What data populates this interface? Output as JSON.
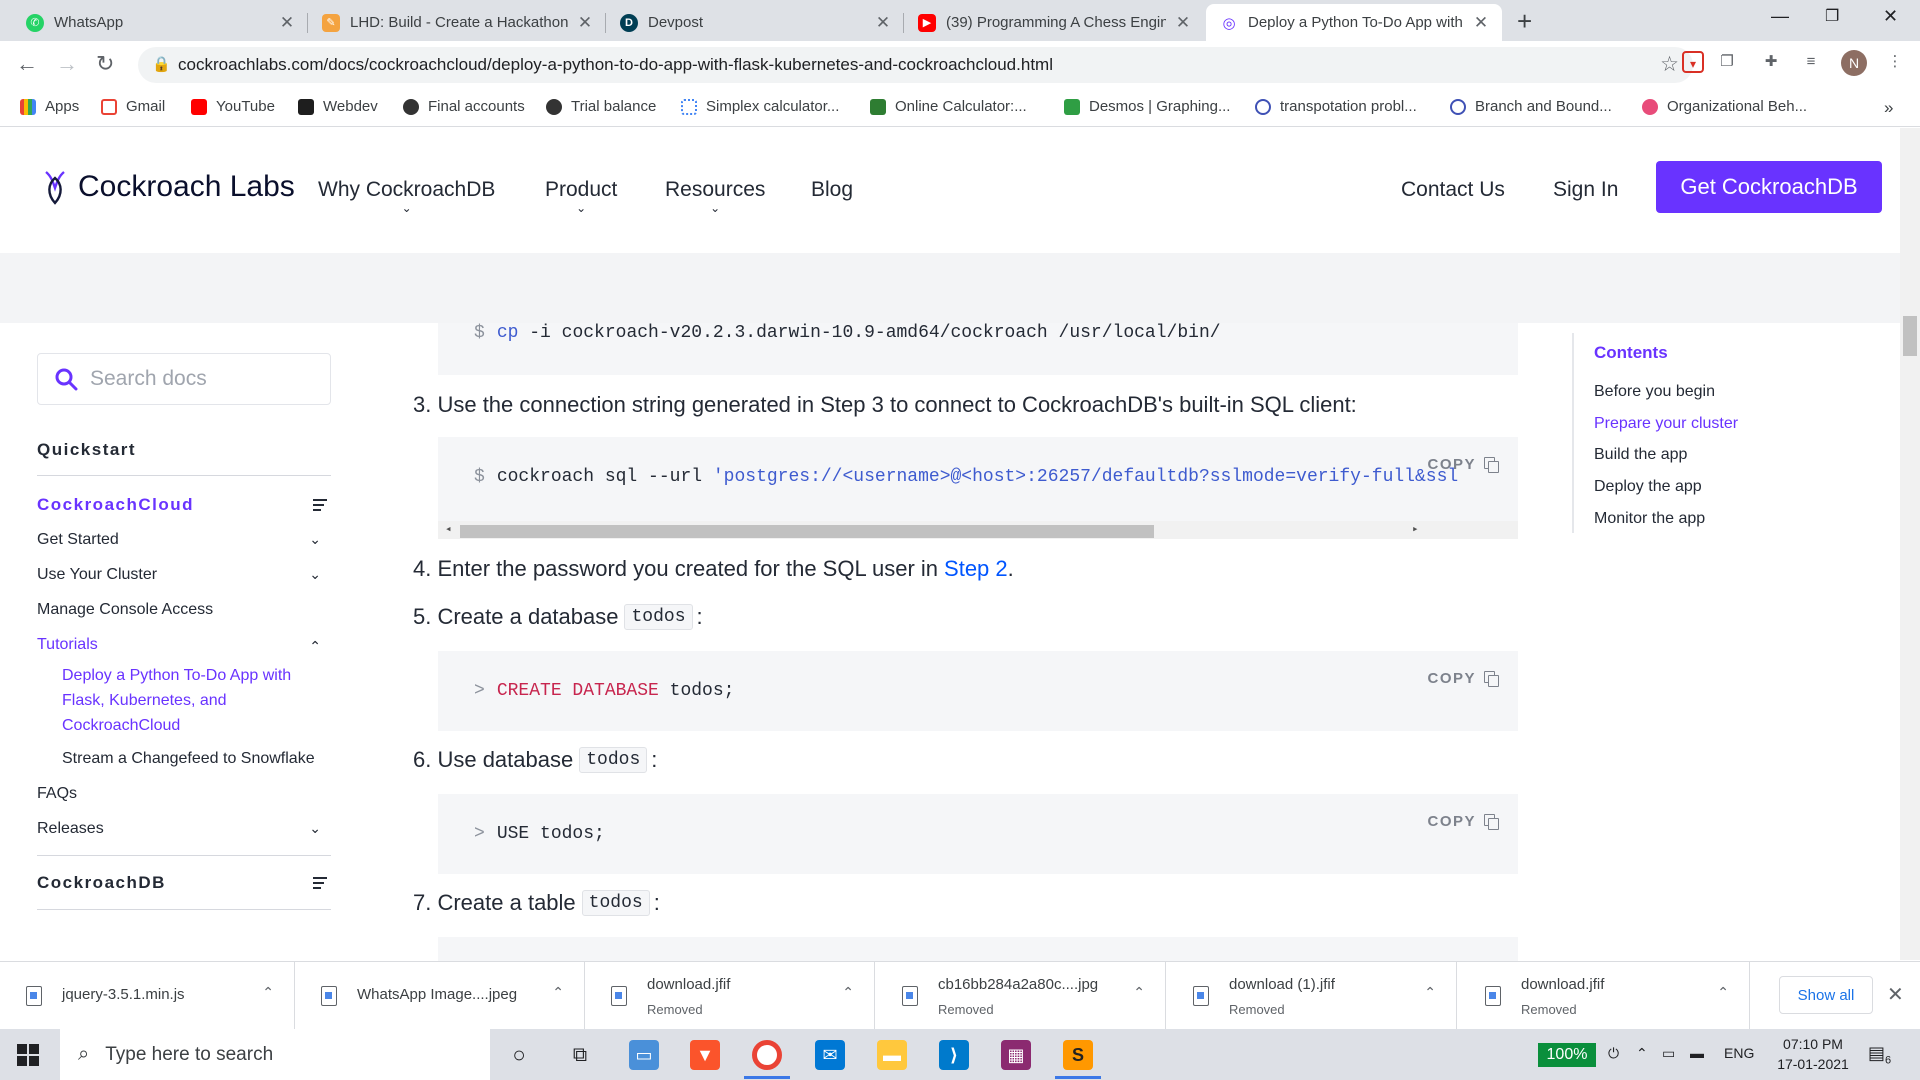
{
  "browser": {
    "tabs": [
      {
        "title": "WhatsApp",
        "icon": "whatsapp-icon",
        "color": "#25d366"
      },
      {
        "title": "LHD: Build - Create a Hackathon",
        "icon": "pencil-icon",
        "color": "#e96a4e"
      },
      {
        "title": "Devpost",
        "icon": "devpost-icon",
        "color": "#003e54"
      },
      {
        "title": "(39) Programming A Chess Engin",
        "icon": "youtube-icon",
        "color": "#ff0000"
      },
      {
        "title": "Deploy a Python To-Do App with",
        "icon": "cockroach-icon",
        "color": "#6933ff"
      }
    ],
    "url": "cockroachlabs.com/docs/cockroachcloud/deploy-a-python-to-do-app-with-flask-kubernetes-and-cockroachcloud.html",
    "profile_initial": "N",
    "bookmarks": [
      "Apps",
      "Gmail",
      "YouTube",
      "Webdev",
      "Final accounts",
      "Trial balance",
      "Simplex calculator...",
      "Online Calculator:...",
      "Desmos | Graphing...",
      "transpotation probl...",
      "Branch and Bound...",
      "Organizational Beh..."
    ]
  },
  "site": {
    "logo_text": "Cockroach Labs",
    "nav": [
      "Why CockroachDB",
      "Product",
      "Resources",
      "Blog"
    ],
    "contact": "Contact Us",
    "signin": "Sign In",
    "cta": "Get CockroachDB",
    "accent": "#6933ff"
  },
  "sidebar": {
    "search_placeholder": "Search docs",
    "quickstart": "Quickstart",
    "cloud_heading": "CockroachCloud",
    "items": [
      "Get Started",
      "Use Your Cluster",
      "Manage Console Access",
      "Tutorials"
    ],
    "sub_items": [
      "Deploy a Python To-Do App with Flask, Kubernetes, and CockroachCloud",
      "Stream a Changefeed to Snowflake"
    ],
    "faqs": "FAQs",
    "releases": "Releases",
    "db_heading": "CockroachDB"
  },
  "content": {
    "cp_prompt": "$",
    "cp_cmd": "cp",
    "cp_rest": "-i cockroach-v20.2.3.darwin-10.9-amd64/cockroach /usr/local/bin/",
    "step3": "3. Use the connection string generated in Step 3 to connect to CockroachDB's built-in SQL client:",
    "sql_prompt": "$",
    "sql_cmd": "cockroach sql --url ",
    "sql_url": "'postgres://<username>@<host>:26257/defaultdb?sslmode=verify-full&ssl",
    "step4_text": "4. Enter the password you created for the SQL user in",
    "step4_link": "Step 2",
    "step4_end": ".",
    "step5_text": "5. Create a database",
    "step5_code": "todos",
    "step5_end": ":",
    "create_prompt": ">",
    "create_kw": "CREATE DATABASE",
    "create_rest": " todos;",
    "step6_text": "6. Use database",
    "step6_code": "todos",
    "step6_end": ":",
    "use_prompt": ">",
    "use_cmd": "USE todos;",
    "step7_text": "7. Create a table",
    "step7_code": "todos",
    "step7_end": ":",
    "copy_label": "COPY"
  },
  "toc": {
    "title": "Contents",
    "items": [
      "Before you begin",
      "Prepare your cluster",
      "Build the app",
      "Deploy the app",
      "Monitor the app"
    ],
    "current_index": 1
  },
  "downloads": [
    {
      "name": "jquery-3.5.1.min.js",
      "status": ""
    },
    {
      "name": "WhatsApp Image....jpeg",
      "status": ""
    },
    {
      "name": "download.jfif",
      "status": "Removed"
    },
    {
      "name": "cb16bb284a2a80c....jpg",
      "status": "Removed"
    },
    {
      "name": "download (1).jfif",
      "status": "Removed"
    },
    {
      "name": "download.jfif",
      "status": "Removed"
    }
  ],
  "downloads_show_all": "Show all",
  "taskbar": {
    "search_placeholder": "Type here to search",
    "battery": "100%",
    "language": "ENG",
    "time": "07:10 PM",
    "date": "17-01-2021",
    "notifications": "6"
  }
}
